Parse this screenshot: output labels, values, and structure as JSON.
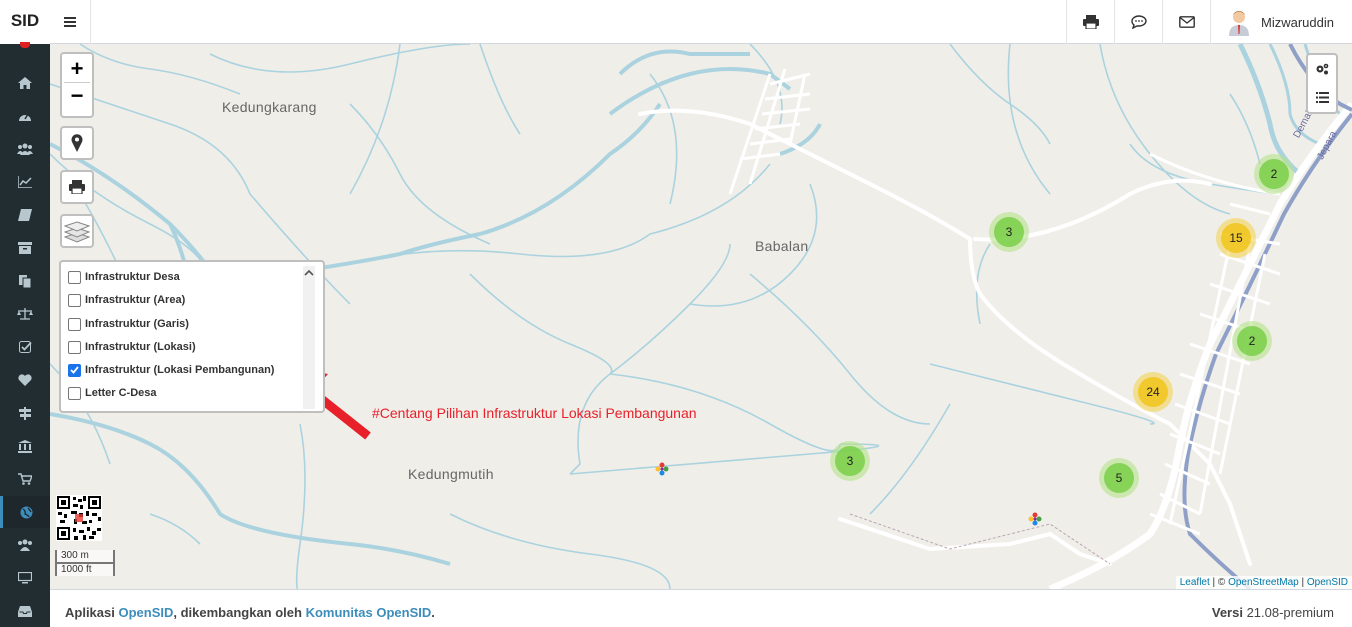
{
  "app": {
    "logo": "SID"
  },
  "header": {
    "user_name": "Mizwaruddin"
  },
  "sidebar": {
    "items": [
      {
        "icon": "home-icon"
      },
      {
        "icon": "dashboard-icon"
      },
      {
        "icon": "users-icon"
      },
      {
        "icon": "chart-icon"
      },
      {
        "icon": "book-icon"
      },
      {
        "icon": "archive-icon"
      },
      {
        "icon": "copy-icon"
      },
      {
        "icon": "balance-scale-icon"
      },
      {
        "icon": "check-square-icon"
      },
      {
        "icon": "heart-icon"
      },
      {
        "icon": "road-sign-icon"
      },
      {
        "icon": "bank-icon"
      },
      {
        "icon": "cart-icon"
      },
      {
        "icon": "globe-icon",
        "active": true
      },
      {
        "icon": "group-icon"
      },
      {
        "icon": "desktop-icon"
      },
      {
        "icon": "inbox-icon"
      }
    ]
  },
  "map": {
    "places": [
      "Kedungkarang",
      "Babalan",
      "Kedungmutih"
    ],
    "zoom_in": "+",
    "zoom_out": "−",
    "clusters": [
      {
        "count": "2",
        "color": "green"
      },
      {
        "count": "3",
        "color": "green"
      },
      {
        "count": "15",
        "color": "yellow"
      },
      {
        "count": "2",
        "color": "green"
      },
      {
        "count": "24",
        "color": "yellow"
      },
      {
        "count": "3",
        "color": "green"
      },
      {
        "count": "5",
        "color": "green"
      }
    ],
    "layers": [
      {
        "label": "Infrastruktur Desa",
        "checked": false
      },
      {
        "label": "Infrastruktur (Area)",
        "checked": false
      },
      {
        "label": "Infrastruktur (Garis)",
        "checked": false
      },
      {
        "label": "Infrastruktur (Lokasi)",
        "checked": false
      },
      {
        "label": "Infrastruktur (Lokasi Pembangunan)",
        "checked": true
      },
      {
        "label": "Letter C-Desa",
        "checked": false
      }
    ],
    "annotation": "#Centang Pilihan Infrastruktur Lokasi Pembangunan",
    "scale": {
      "metric": "300 m",
      "imperial": "1000 ft"
    },
    "road_label_1": "Demak",
    "road_label_2": "Jepara",
    "attribution": {
      "leaflet": "Leaflet",
      "sep1": " | © ",
      "osm": "OpenStreetMap",
      "sep2": " | ",
      "opensid": "OpenSID"
    }
  },
  "footer": {
    "prefix": "Aplikasi ",
    "app_link": "OpenSID",
    "middle": ", dikembangkan oleh ",
    "community_link": "Komunitas OpenSID",
    "suffix": ".",
    "version_label": "Versi",
    "version": " 21.08-premium"
  },
  "colors": {
    "sidebar": "#222d32",
    "water": "#aad3df",
    "annotation": "#e8202a",
    "link": "#3c8dbc"
  }
}
